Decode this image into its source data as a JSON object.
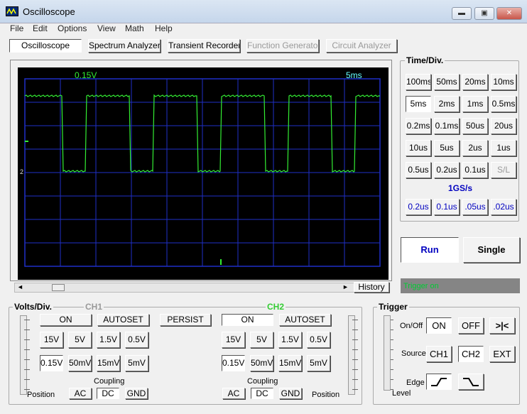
{
  "window": {
    "title": "Oscilloscope",
    "minimize": "▬",
    "maximize": "▣",
    "close": "✕"
  },
  "menu": [
    "File",
    "Edit",
    "Options",
    "View",
    "Math",
    "Help"
  ],
  "tabs": [
    "Oscilloscope",
    "Spectrum Analyzer",
    "Transient Recorder",
    "Function Generator",
    "Circuit Analyzer"
  ],
  "screen": {
    "volt_label": "0.15V",
    "time_label": "5ms",
    "ch_marker": "2",
    "trace_color": "#33ee33",
    "grid_color": "#1f2fc8"
  },
  "scroll": {
    "left": "◄",
    "right": "►",
    "history": "History"
  },
  "timediv": {
    "label": "Time/Div.",
    "buttons": [
      "100ms",
      "50ms",
      "20ms",
      "10ms",
      "5ms",
      "2ms",
      "1ms",
      "0.5ms",
      "0.2ms",
      "0.1ms",
      "50us",
      "20us",
      "10us",
      "5us",
      "2us",
      "1us",
      "0.5us",
      "0.2us",
      "0.1us",
      "S/L"
    ],
    "rate": "1GS/s",
    "fast": [
      "0.2us",
      "0.1us",
      ".05us",
      ".02us"
    ],
    "selected": "5ms"
  },
  "run": "Run",
  "single": "Single",
  "trigger_status": "Trigger on",
  "volts": {
    "label": "Volts/Div.",
    "ch1": "CH1",
    "ch2": "CH2",
    "on": "ON",
    "autoset": "AUTOSET",
    "persist": "PERSIST",
    "values": [
      "15V",
      "5V",
      "1.5V",
      "0.5V",
      "0.15V",
      "50mV",
      "15mV",
      "5mV"
    ],
    "coupling": "Coupling",
    "ac": "AC",
    "dc": "DC",
    "gnd": "GND",
    "position": "Position"
  },
  "trigger": {
    "label": "Trigger",
    "onoff": "On/Off",
    "on": "ON",
    "off": "OFF",
    "arrow": ">|<",
    "source": "Source",
    "ch1": "CH1",
    "ch2": "CH2",
    "ext": "EXT",
    "edge": "Edge",
    "level": "Level"
  }
}
